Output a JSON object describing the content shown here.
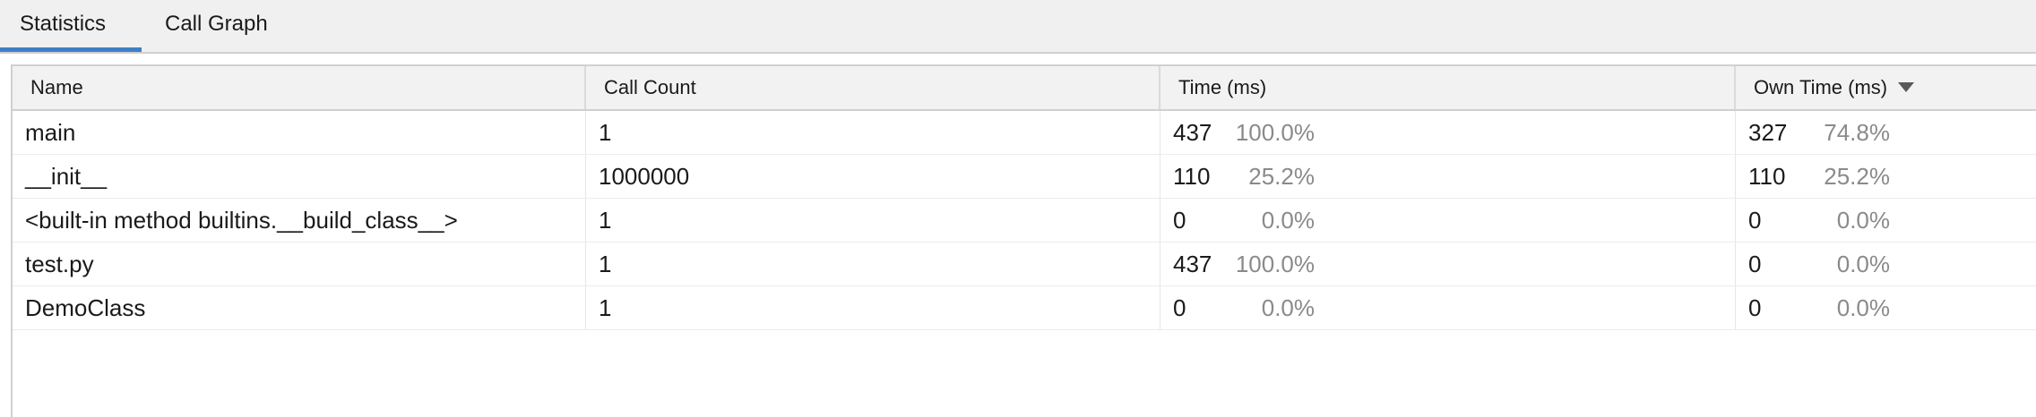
{
  "tabs": [
    {
      "label": "Statistics"
    },
    {
      "label": "Call Graph"
    }
  ],
  "table": {
    "columns": [
      "Name",
      "Call Count",
      "Time (ms)",
      "Own Time (ms)"
    ],
    "rows": [
      {
        "name": "main",
        "calls": "1",
        "time": "437",
        "time_pct": "100.0%",
        "own": "327",
        "own_pct": "74.8%"
      },
      {
        "name": "__init__",
        "calls": "1000000",
        "time": "110",
        "time_pct": "25.2%",
        "own": "110",
        "own_pct": "25.2%"
      },
      {
        "name": "<built-in method builtins.__build_class__>",
        "calls": "1",
        "time": "0",
        "time_pct": "0.0%",
        "own": "0",
        "own_pct": "0.0%"
      },
      {
        "name": "test.py",
        "calls": "1",
        "time": "437",
        "time_pct": "100.0%",
        "own": "0",
        "own_pct": "0.0%"
      },
      {
        "name": "DemoClass",
        "calls": "1",
        "time": "0",
        "time_pct": "0.0%",
        "own": "0",
        "own_pct": "0.0%"
      }
    ]
  }
}
